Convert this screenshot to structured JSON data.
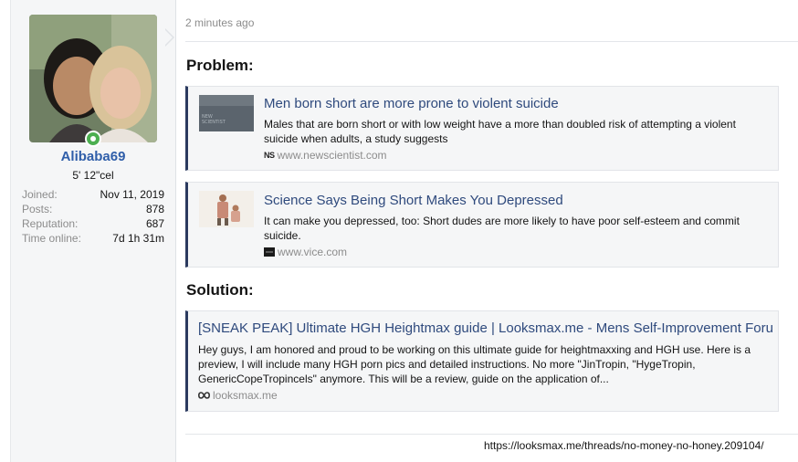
{
  "user": {
    "name": "Alibaba69",
    "title": "5' 12\"cel",
    "stats": [
      {
        "label": "Joined:",
        "value": "Nov 11, 2019"
      },
      {
        "label": "Posts:",
        "value": "878"
      },
      {
        "label": "Reputation:",
        "value": "687"
      },
      {
        "label": "Time online:",
        "value": "7d 1h 31m"
      }
    ]
  },
  "post": {
    "time": "2 minutes ago",
    "problem_heading": "Problem:",
    "solution_heading": "Solution:",
    "cards": [
      {
        "title": "Men born short are more prone to violent suicide",
        "desc": "Males that are born short or with low weight have a more than doubled risk of attempting a violent suicide when adults, a study suggests",
        "source": "www.newscientist.com",
        "source_badge": "NS"
      },
      {
        "title": "Science Says Being Short Makes You Depressed",
        "desc": "It can make you depressed, too: Short dudes are more likely to have poor self-esteem and commit suicide.",
        "source": "www.vice.com",
        "source_badge": ""
      },
      {
        "title": "[SNEAK PEAK] Ultimate HGH Heightmax guide | Looksmax.me - Mens Self-Improvement Foru...",
        "desc": "Hey guys, I am honored and proud to be working on this ultimate guide for heightmaxxing and HGH use. Here is a preview, I will include many HGH porn pics and detailed instructions. No more \"JinTropin, \"HygeTropin, GenericCopeTropincels\" anymore. This will be a review, guide on the application of...",
        "source": "looksmax.me",
        "source_badge": ""
      }
    ],
    "thread_url": "https://looksmax.me/threads/no-money-no-honey.209104/"
  },
  "colors": {
    "accent": "#2f5ea9",
    "card_border": "#2b3a5f",
    "online": "#4caf50"
  }
}
